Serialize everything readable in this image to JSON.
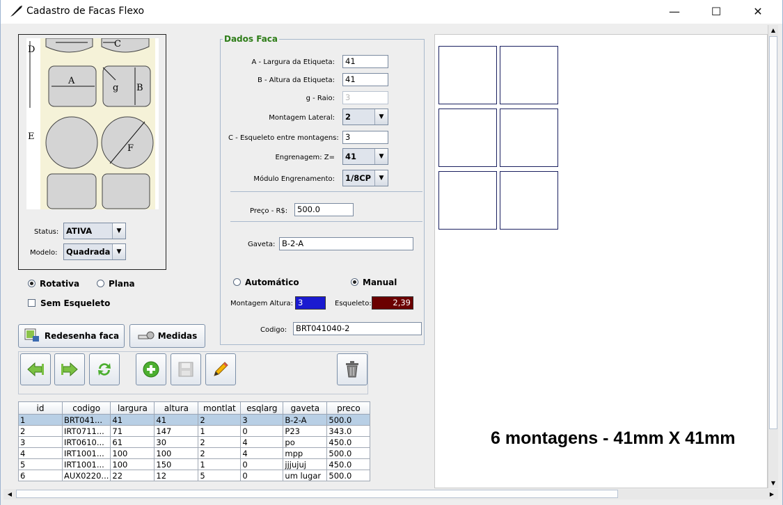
{
  "window": {
    "title": "Cadastro de Facas Flexo",
    "minimize": "—",
    "maximize": "☐",
    "close": "✕"
  },
  "diagram": {
    "labels": {
      "d": "D",
      "c": "C",
      "a": "A",
      "g": "g",
      "b": "B",
      "e": "E",
      "f": "F"
    }
  },
  "left_form": {
    "status_label": "Status:",
    "status_value": "ATIVA",
    "modelo_label": "Modelo:",
    "modelo_value": "Quadrada",
    "radio_rotativa": "Rotativa",
    "radio_plana": "Plana",
    "rotativa_selected": true,
    "sem_esqueleto": "Sem Esqueleto",
    "sem_esqueleto_checked": false,
    "redesenha_button": "Redesenha faca",
    "medidas_button": "Medidas"
  },
  "dados_faca": {
    "title": "Dados Faca",
    "largura_label": "A - Largura da Etiqueta:",
    "largura_value": "41",
    "altura_label": "B - Altura da Etiqueta:",
    "altura_value": "41",
    "raio_label": "g - Raio:",
    "raio_value": "3",
    "montagem_lateral_label": "Montagem Lateral:",
    "montagem_lateral_value": "2",
    "esqueleto_label": "C - Esqueleto entre montagens:",
    "esqueleto_value": "3",
    "engrenagem_label": "Engrenagem: Z=",
    "engrenagem_value": "41",
    "modulo_label": "Módulo Engrenamento:",
    "modulo_value": "1/8CP",
    "preco_label": "Preço - R$:",
    "preco_value": "500.0",
    "gaveta_label": "Gaveta:",
    "gaveta_value": "B-2-A",
    "automatico": "Automático",
    "manual": "Manual",
    "manual_selected": true,
    "montagem_altura_label": "Montagem Altura:",
    "montagem_altura_value": "3",
    "esqueleto2_label": "Esqueleto:",
    "esqueleto2_value": "2,39",
    "codigo_label": "Codigo:",
    "codigo_value": "BRT041040-2"
  },
  "colors": {
    "accent_green": "#2e7d18",
    "montagem_bg": "#1a1ad0",
    "esqueleto_bg": "#6b0000",
    "square_border": "#1a2060"
  },
  "preview": {
    "caption": "6 montagens - 41mm X 41mm"
  },
  "table": {
    "columns": [
      "id",
      "codigo",
      "largura",
      "altura",
      "montlat",
      "esqlarg",
      "gaveta",
      "preco"
    ],
    "rows": [
      [
        "1",
        "BRT041...",
        "41",
        "41",
        "2",
        "3",
        "B-2-A",
        "500.0"
      ],
      [
        "2",
        "IRT0711...",
        "71",
        "147",
        "1",
        "0",
        "P23",
        "343.0"
      ],
      [
        "3",
        "IRT0610...",
        "61",
        "30",
        "2",
        "4",
        "po",
        "450.0"
      ],
      [
        "4",
        "IRT1001...",
        "100",
        "100",
        "2",
        "4",
        "mpp",
        "500.0"
      ],
      [
        "5",
        "IRT1001...",
        "100",
        "150",
        "1",
        "0",
        "jjjujuj",
        "450.0"
      ],
      [
        "6",
        "AUX0220...",
        "22",
        "12",
        "5",
        "0",
        "um lugar",
        "500.0"
      ]
    ]
  }
}
